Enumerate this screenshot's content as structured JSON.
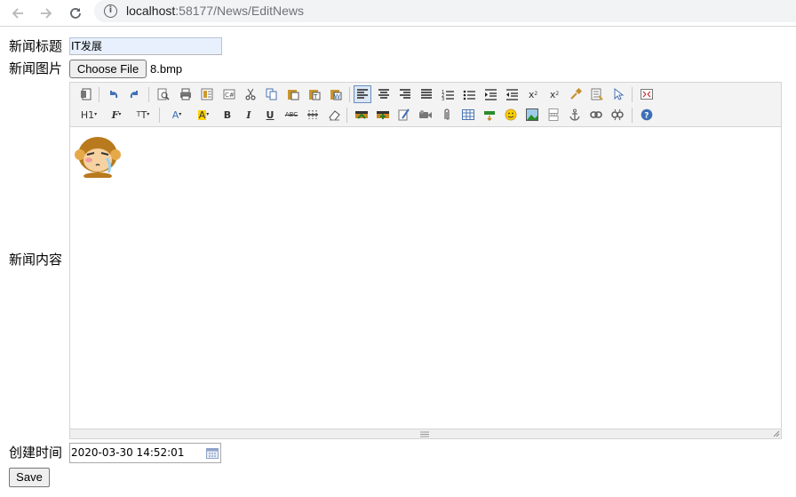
{
  "browser": {
    "url_host": "localhost",
    "url_path": ":58177/News/EditNews"
  },
  "form": {
    "title_label": "新闻标题",
    "title_value": "IT发展",
    "image_label": "新闻图片",
    "file_button": "Choose File",
    "file_name": "8.bmp",
    "content_label": "新闻内容",
    "created_label": "创建时间",
    "created_value": "2020-03-30 14:52:01",
    "save_label": "Save"
  },
  "toolbar": {
    "heading": "H1",
    "bold": "B",
    "italic": "I",
    "underline": "U",
    "strike": "ABC",
    "subscript": "x",
    "superscript": "x"
  },
  "icons": {
    "accent": "#3d6fb6",
    "highlight": "#ffd200"
  }
}
